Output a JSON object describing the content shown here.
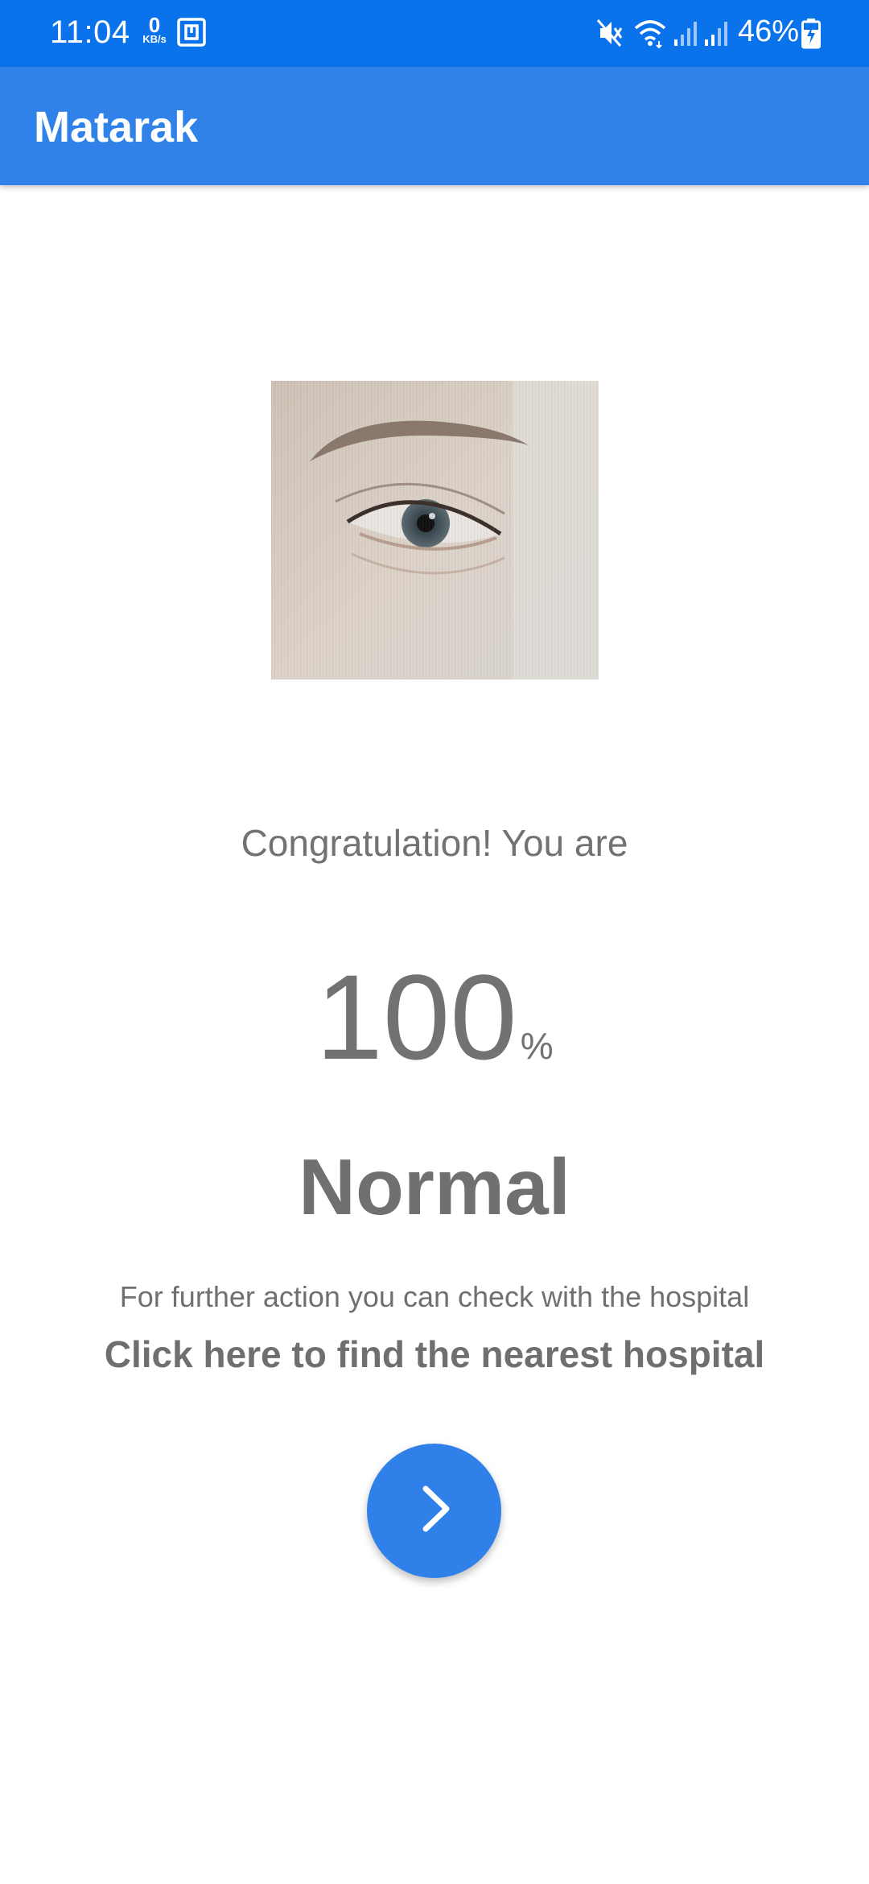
{
  "status_bar": {
    "time": "11:04",
    "net_speed_value": "0",
    "net_speed_unit": "KB/s",
    "battery_percent": "46%",
    "icons": [
      "nfc-icon",
      "mute-icon",
      "wifi-icon",
      "signal-icon-1",
      "signal-icon-2",
      "battery-charging-icon"
    ]
  },
  "app_bar": {
    "title": "Matarak"
  },
  "result": {
    "image": "eye-photo",
    "congrats_text": "Congratulation! You are",
    "percent_value": "100",
    "percent_sign": "%",
    "status": "Normal",
    "further_action_text": "For further action you can check with the hospital",
    "find_hospital_link": "Click here to find the nearest hospital"
  },
  "fab": {
    "icon": "chevron-right-icon"
  },
  "colors": {
    "status_bar": "#0a73eb",
    "app_bar": "#3182e8",
    "fab": "#2f80e9",
    "text_gray": "#727272"
  }
}
